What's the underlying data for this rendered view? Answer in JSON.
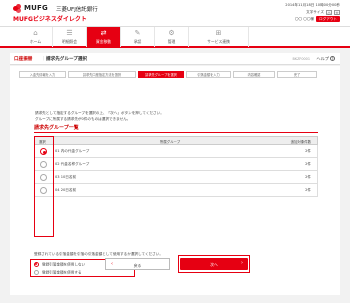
{
  "header": {
    "brand": "MUFG",
    "bank_name": "三菱UFJ信託銀行",
    "service_name": "MUFGビジネスダイレクト",
    "datetime": "2014年11月18日 10時00分00秒",
    "font_size_label": "文字サイズ",
    "font_small": "小",
    "font_large": "大",
    "user": "〇〇 〇〇様",
    "logout": "ログアウト"
  },
  "nav": [
    {
      "label": "ホーム",
      "icon": "home-icon",
      "glyph": "⌂"
    },
    {
      "label": "明細照会",
      "icon": "list-icon",
      "glyph": "☰"
    },
    {
      "label": "資金移動",
      "icon": "transfer-icon",
      "glyph": "⇄",
      "active": true
    },
    {
      "label": "承認",
      "icon": "approval-icon",
      "glyph": "✎"
    },
    {
      "label": "管理",
      "icon": "settings-icon",
      "glyph": "⚙"
    },
    {
      "label": "サービス連携",
      "icon": "link-icon",
      "glyph": "⊞"
    }
  ],
  "titlebar": {
    "category": "口座振替",
    "separator": "｜",
    "title": "請求先グループ選択",
    "code": "BKZF0001",
    "help": "ヘルプ",
    "help_glyph": "?"
  },
  "steps": [
    "入金先情報を入力",
    "請求先口座指定方法を選択",
    "請求先グループを選択",
    "引落金額を入力",
    "内容確認",
    "完了"
  ],
  "description": [
    "請求先として指定するグループを選択の上、「次へ」ボタンを押してください。",
    "グループに所属する請求先が0件のものは選択できません。"
  ],
  "section_title": "請求先グループ一覧",
  "table": {
    "headers": {
      "select": "選択",
      "group": "所属グループ",
      "count": "追加対象件数"
    },
    "rows": [
      {
        "name": "01 内の代金グループ",
        "count": "2件",
        "selected": true
      },
      {
        "name": "02 代金名称グループ",
        "count": "2件",
        "selected": false
      },
      {
        "name": "03 10日名前",
        "count": "2件",
        "selected": false
      },
      {
        "name": "04 20日名前",
        "count": "2件",
        "selected": false
      }
    ]
  },
  "options": {
    "description": "登録されている引落金額を引落の引落金額として使用するか選択してください。",
    "items": [
      {
        "label": "登録引落金額を使用しない",
        "selected": true
      },
      {
        "label": "登録引落金額を使用する",
        "selected": false
      }
    ]
  },
  "buttons": {
    "back": "戻る",
    "back_glyph": "‹",
    "next": "次へ",
    "next_glyph": "›"
  },
  "colors": {
    "accent": "#e60012",
    "background": "#f2f2f2"
  }
}
